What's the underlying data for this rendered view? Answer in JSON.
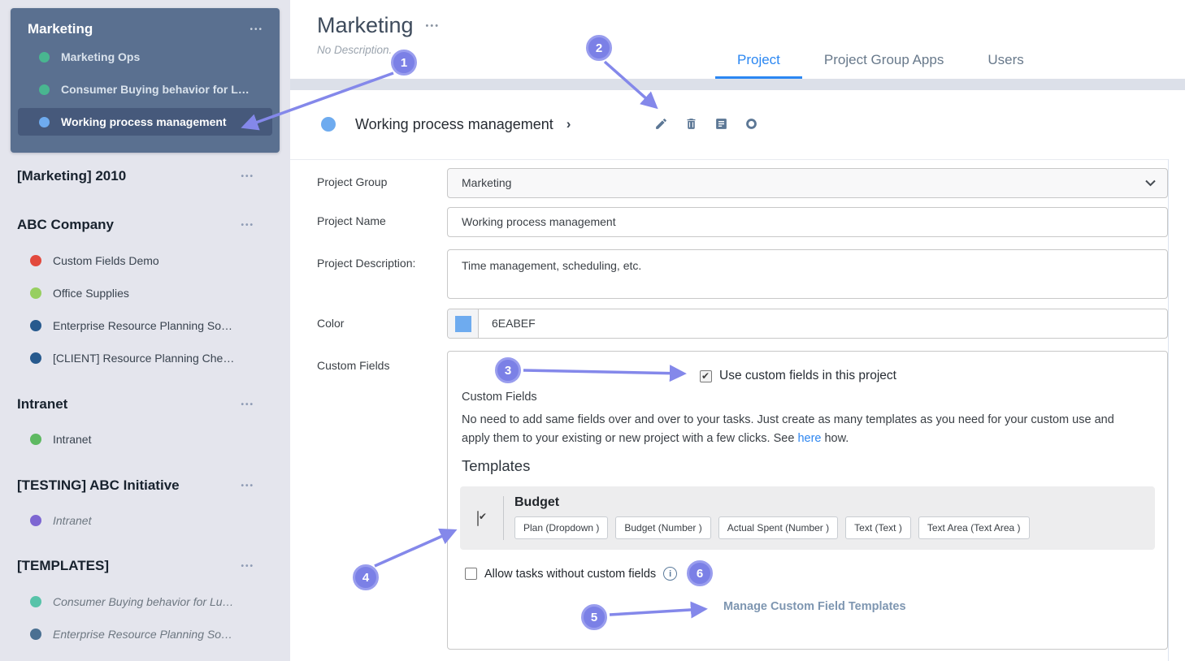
{
  "icons": {
    "more": "•••",
    "chevron_right": "›",
    "info": "i"
  },
  "colors": {
    "accent_blue": "#2b87f2",
    "badge_purple": "#7b80e6",
    "link_blue": "#2e86f0",
    "manage_link": "#7e96b1",
    "project_color": "#6eabef"
  },
  "sidebar": {
    "marketing_card": {
      "title": "Marketing",
      "items": [
        {
          "label": "Marketing Ops",
          "dot": "#49b690"
        },
        {
          "label": "Consumer Buying behavior for L…",
          "dot": "#49b690"
        },
        {
          "label": "Working process management",
          "dot": "#6eabef",
          "selected": true
        }
      ]
    },
    "sections": [
      {
        "title": "[Marketing] 2010"
      },
      {
        "title": "ABC Company",
        "items": [
          {
            "label": "Custom Fields Demo",
            "dot": "#e2493d"
          },
          {
            "label": "Office Supplies",
            "dot": "#97cf60"
          },
          {
            "label": "Enterprise Resource Planning So…",
            "dot": "#275a8e"
          },
          {
            "label": "[CLIENT] Resource Planning Che…",
            "dot": "#275a8e"
          }
        ]
      },
      {
        "title": "Intranet",
        "items": [
          {
            "label": "Intranet",
            "dot": "#5eb962"
          }
        ]
      },
      {
        "title": "[TESTING] ABC Initiative",
        "items": [
          {
            "label": "Intranet",
            "dot": "#7d66d2",
            "italic": true
          }
        ]
      },
      {
        "title": "[TEMPLATES]",
        "items": [
          {
            "label": "Consumer Buying behavior for Lu…",
            "dot": "#57c3a9",
            "italic": true
          },
          {
            "label": "Enterprise Resource Planning So…",
            "dot": "#4a7092",
            "italic": true
          }
        ]
      }
    ]
  },
  "header": {
    "title": "Marketing",
    "subtitle": "No Description.",
    "tabs": [
      {
        "label": "Project",
        "active": true
      },
      {
        "label": "Project Group Apps",
        "active": false
      },
      {
        "label": "Users",
        "active": false
      }
    ]
  },
  "project_bar": {
    "title": "Working process management",
    "dot": "#6eabef"
  },
  "form": {
    "project_group": {
      "label": "Project Group",
      "value": "Marketing"
    },
    "project_name": {
      "label": "Project Name",
      "value": "Working process management"
    },
    "project_description": {
      "label": "Project Description:",
      "value": "Time management, scheduling, etc."
    },
    "color": {
      "label": "Color",
      "value": "6EABEF",
      "swatch": "#6eabef"
    },
    "custom_fields": {
      "label": "Custom Fields",
      "use_checkbox": {
        "label": "Use custom fields in this project",
        "checked": true
      },
      "section_title": "Custom Fields",
      "description_line1": "No need to add same fields over and over to your tasks. Just create as many templates as you need for your custom use and",
      "description_line2_before": "apply them to your existing or new project with a few clicks. See ",
      "description_link": "here",
      "description_line2_after": " how.",
      "templates_title": "Templates",
      "template": {
        "name": "Budget",
        "checked": true,
        "chips": [
          "Plan (Dropdown )",
          "Budget (Number )",
          "Actual Spent (Number )",
          "Text (Text )",
          "Text Area (Text Area )"
        ]
      },
      "allow_checkbox": {
        "label": "Allow tasks without custom fields",
        "checked": false
      },
      "manage_link": "Manage Custom Field Templates"
    }
  },
  "annotations": {
    "badges": [
      "1",
      "2",
      "3",
      "4",
      "5",
      "6"
    ]
  }
}
